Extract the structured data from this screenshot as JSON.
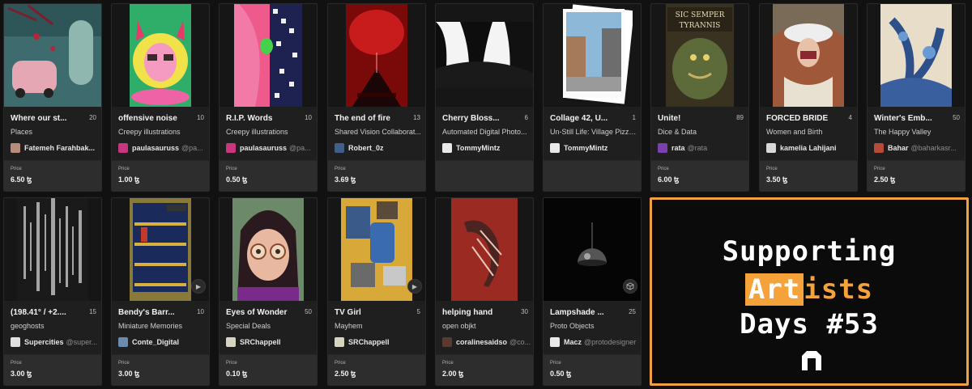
{
  "currency_symbol": "ꜩ",
  "price_label": "Price",
  "cards": [
    {
      "title": "Where our st...",
      "count": "20",
      "collection": "Places",
      "creator": "Fatemeh Farahbak...",
      "handle": "",
      "price": "6.50 ꜩ",
      "icon": "avatar-image"
    },
    {
      "title": "offensive noise",
      "count": "10",
      "collection": "Creepy illustrations",
      "creator": "paulasauruss",
      "handle": "@pa...",
      "price": "1.00 ꜩ",
      "icon": "avatar-image"
    },
    {
      "title": "R.I.P. Words",
      "count": "10",
      "collection": "Creepy illustrations",
      "creator": "paulasauruss",
      "handle": "@pa...",
      "price": "0.50 ꜩ",
      "icon": "avatar-image"
    },
    {
      "title": "The end of fire",
      "count": "13",
      "collection": "Shared Vision Collaborat...",
      "creator": "Robert_0z",
      "handle": "",
      "price": "3.69 ꜩ",
      "icon": "avatar-image"
    },
    {
      "title": "Cherry Bloss...",
      "count": "6",
      "collection": "Automated Digital Photo...",
      "creator": "TommyMintz",
      "handle": "",
      "price": "",
      "icon": "avatar-image"
    },
    {
      "title": "Collage 42, U...",
      "count": "1",
      "collection": "Un-Still Life: Village Pizza...",
      "creator": "TommyMintz",
      "handle": "",
      "price": "",
      "icon": "avatar-image"
    },
    {
      "title": "Unite!",
      "count": "89",
      "collection": "Dice & Data",
      "creator": "rata",
      "handle": "@rata",
      "price": "6.00 ꜩ",
      "icon": "avatar-image"
    },
    {
      "title": "FORCED BRIDE",
      "count": "4",
      "collection": "Women and Birth",
      "creator": "kamelia Lahijani",
      "handle": "",
      "price": "3.50 ꜩ",
      "icon": "avatar-image"
    },
    {
      "title": "Winter's Emb...",
      "count": "50",
      "collection": "The Happy Valley",
      "creator": "Bahar",
      "handle": "@baharkasr...",
      "price": "2.50 ꜩ",
      "icon": "avatar-image"
    },
    {
      "title": "(198.41° / +2....",
      "count": "15",
      "collection": "geoghosts",
      "creator": "Supercities",
      "handle": "@super...",
      "price": "3.00 ꜩ",
      "icon": "avatar-image"
    },
    {
      "title": "Bendy's Barr...",
      "count": "10",
      "collection": "Miniature Memories",
      "creator": "Conte_Digital",
      "handle": "",
      "price": "3.00 ꜩ",
      "icon": "avatar-image"
    },
    {
      "title": "Eyes of Wonder",
      "count": "50",
      "collection": "Special Deals",
      "creator": "SRChappell",
      "handle": "",
      "price": "0.10 ꜩ",
      "icon": "avatar-image"
    },
    {
      "title": "TV Girl",
      "count": "5",
      "collection": "Mayhem",
      "creator": "SRChappell",
      "handle": "",
      "price": "2.50 ꜩ",
      "icon": "avatar-image"
    },
    {
      "title": "helping hand",
      "count": "30",
      "collection": "open objkt",
      "creator": "coralinesaidso",
      "handle": "@co...",
      "price": "2.00 ꜩ",
      "icon": "avatar-image"
    },
    {
      "title": "Lampshade ...",
      "count": "25",
      "collection": "Proto Objects",
      "creator": "Macz",
      "handle": "@protodesigner",
      "price": "0.50 ꜩ",
      "icon": "avatar-image"
    }
  ],
  "promo": {
    "line1": "Supporting",
    "line2_highlight": "Art",
    "line2_rest": "ists",
    "line3": "Days #53",
    "logo_icon": "objkt-logo-icon",
    "border_color": "#f0a040",
    "accent_color": "#f5a23a"
  }
}
